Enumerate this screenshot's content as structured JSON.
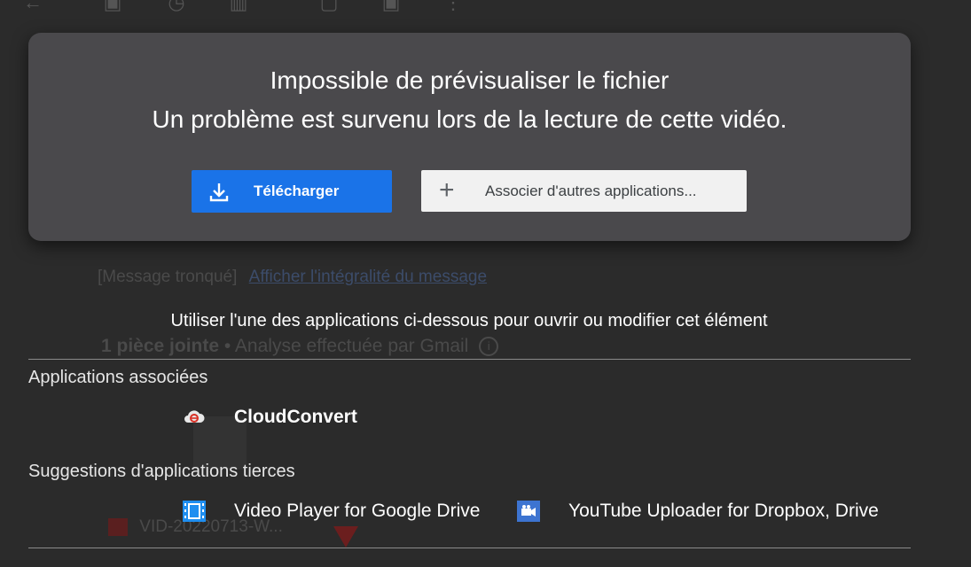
{
  "card": {
    "title": "Impossible de prévisualiser le fichier",
    "subtitle": "Un problème est survenu lors de la lecture de cette vidéo.",
    "download_label": "Télécharger",
    "associate_label": "Associer d'autres applications..."
  },
  "hint": "Utiliser l'une des applications ci-dessous pour ouvrir ou modifier cet élément",
  "sections": {
    "associated": {
      "label": "Applications associées",
      "apps": [
        {
          "name": "CloudConvert",
          "icon": "cloudconvert-icon"
        }
      ]
    },
    "suggested": {
      "label": "Suggestions d'applications tierces",
      "apps": [
        {
          "name": "Video Player for Google Drive",
          "icon": "film-icon"
        },
        {
          "name": "YouTube Uploader for Dropbox, Drive",
          "icon": "video-camera-icon"
        }
      ]
    }
  },
  "background": {
    "truncated": "[Message tronqué]",
    "show_full": "Afficher l'intégralité du message",
    "attachment_count": "1 pièce jointe",
    "scan_note": "• Analyse effectuée par Gmail",
    "file_name": "VID-20220713-W..."
  },
  "colors": {
    "accent": "#1a73e8",
    "card_bg": "#4a494c",
    "page_bg": "#2b2b2b"
  }
}
